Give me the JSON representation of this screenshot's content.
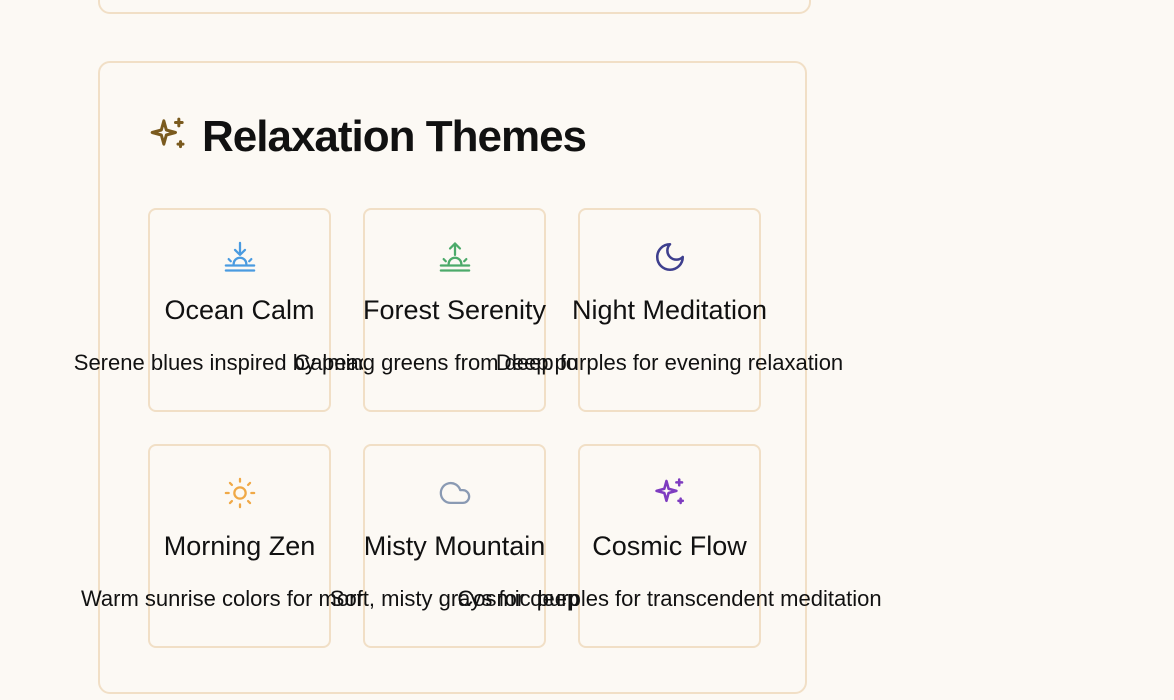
{
  "section": {
    "title": "Relaxation Themes",
    "icon": "sparkles-icon",
    "icon_color": "#7a5a1e"
  },
  "themes": [
    {
      "name": "Ocean Calm",
      "description": "Serene blues inspired by peaceful",
      "icon": "sunset-icon",
      "icon_color": "#4a9be0"
    },
    {
      "name": "Forest Serenity",
      "description": "Calming greens from deep forest",
      "icon": "sunrise-icon",
      "icon_color": "#4caa6a"
    },
    {
      "name": "Night Meditation",
      "description": "Deep purples for evening relaxation",
      "icon": "moon-icon",
      "icon_color": "#3e3f8e"
    },
    {
      "name": "Morning Zen",
      "description": "Warm sunrise colors for morning",
      "icon": "sun-icon",
      "icon_color": "#f0a947"
    },
    {
      "name": "Misty Mountain",
      "description": "Soft, misty grays for deep",
      "icon": "cloud-icon",
      "icon_color": "#8a9ab3"
    },
    {
      "name": "Cosmic Flow",
      "description": "Cosmic purples for transcendent meditation",
      "icon": "sparkles-icon",
      "icon_color": "#7e3cc0"
    }
  ]
}
